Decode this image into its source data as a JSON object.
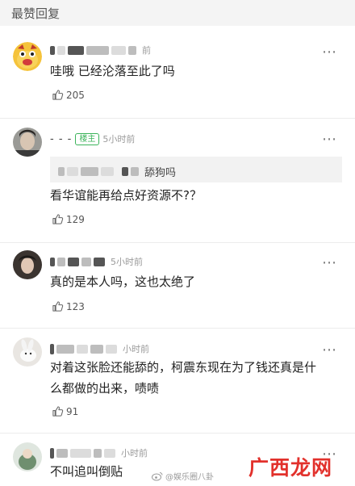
{
  "header": {
    "title": "最赞回复"
  },
  "comments": [
    {
      "time": "前",
      "text": "哇哦 已经沦落至此了吗",
      "likes": "205"
    },
    {
      "time": "5小时前",
      "badge": "楼主",
      "quote_text": "舔狗吗",
      "text": "看华谊能再给点好资源不?？",
      "likes": "129"
    },
    {
      "time": "5小时前",
      "text": "真的是本人吗，这也太绝了",
      "likes": "123"
    },
    {
      "time": "小时前",
      "text_line1": "对着这张脸还能舔的，柯震东现在为了钱还真是什",
      "text_line2": "么都做的出来，啧啧",
      "likes": "91"
    },
    {
      "time": "小时前",
      "text": "不叫追叫倒贴"
    }
  ],
  "more_icon": "⋯",
  "watermark": {
    "text": "@娱乐圈八卦"
  },
  "brand": {
    "text": "广西龙网",
    "color": "#e2312c"
  },
  "colors": {
    "host_badge": "#3bb35a",
    "header_bg": "#f4f4f4"
  }
}
